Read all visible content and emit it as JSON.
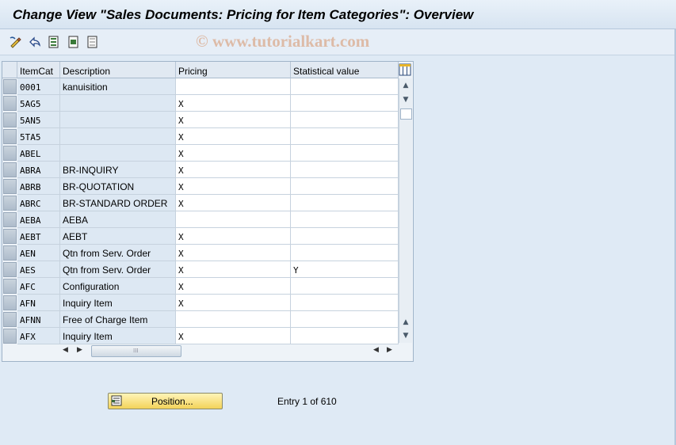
{
  "window": {
    "title": "Change View \"Sales Documents: Pricing for Item Categories\": Overview",
    "watermark": "© www.tutorialkart.com"
  },
  "toolbar": {
    "icons": [
      "change-display-icon",
      "undo-icon",
      "select-all-icon",
      "select-block-icon",
      "deselect-all-icon"
    ]
  },
  "table": {
    "columns": [
      "ItemCat",
      "Description",
      "Pricing",
      "Statistical value"
    ],
    "rows": [
      {
        "cat": "0001",
        "desc": "kanuisition",
        "pricing": "",
        "stat": ""
      },
      {
        "cat": "5AG5",
        "desc": "",
        "pricing": "X",
        "stat": ""
      },
      {
        "cat": "5AN5",
        "desc": "",
        "pricing": "X",
        "stat": ""
      },
      {
        "cat": "5TA5",
        "desc": "",
        "pricing": "X",
        "stat": ""
      },
      {
        "cat": "ABEL",
        "desc": "",
        "pricing": "X",
        "stat": ""
      },
      {
        "cat": "ABRA",
        "desc": "BR-INQUIRY",
        "pricing": "X",
        "stat": ""
      },
      {
        "cat": "ABRB",
        "desc": "BR-QUOTATION",
        "pricing": "X",
        "stat": ""
      },
      {
        "cat": "ABRC",
        "desc": "BR-STANDARD ORDER",
        "pricing": "X",
        "stat": ""
      },
      {
        "cat": "AEBA",
        "desc": "AEBA",
        "pricing": "",
        "stat": ""
      },
      {
        "cat": "AEBT",
        "desc": "AEBT",
        "pricing": "X",
        "stat": ""
      },
      {
        "cat": "AEN",
        "desc": "Qtn from Serv. Order",
        "pricing": "X",
        "stat": ""
      },
      {
        "cat": "AES",
        "desc": "Qtn from Serv. Order",
        "pricing": "X",
        "stat": "Y"
      },
      {
        "cat": "AFC",
        "desc": "Configuration",
        "pricing": "X",
        "stat": ""
      },
      {
        "cat": "AFN",
        "desc": "Inquiry Item",
        "pricing": "X",
        "stat": ""
      },
      {
        "cat": "AFNN",
        "desc": "Free of Charge Item",
        "pricing": "",
        "stat": ""
      },
      {
        "cat": "AFX",
        "desc": "Inquiry Item",
        "pricing": "X",
        "stat": ""
      }
    ]
  },
  "footer": {
    "position_label": "Position...",
    "entry_text": "Entry 1 of 610"
  },
  "colors": {
    "background": "#dfeaf5",
    "button_yellow": "#f3d35a"
  }
}
